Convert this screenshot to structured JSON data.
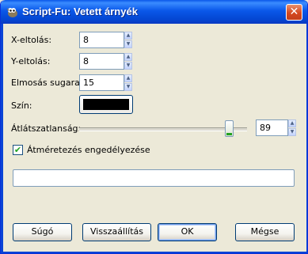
{
  "window": {
    "title": "Script-Fu: Vetett árnyék",
    "close_glyph": "✕"
  },
  "form": {
    "x_offset": {
      "label": "X-eltolás:",
      "value": "8"
    },
    "y_offset": {
      "label": "Y-eltolás:",
      "value": "8"
    },
    "blur_radius": {
      "label": "Elmosás sugara:",
      "value": "15"
    },
    "color": {
      "label": "Szín:",
      "value": "#000000"
    },
    "opacity": {
      "label": "Átlátszatlanság:",
      "value": "89",
      "fraction": 0.89
    },
    "resize_checkbox": {
      "label": "Átméretezés engedélyezése",
      "checked": true
    },
    "status_text": ""
  },
  "buttons": {
    "help": "Súgó",
    "reset": "Visszaállítás",
    "ok": "OK",
    "cancel": "Mégse"
  },
  "icons": {
    "app": "gimp-wilber-icon",
    "close": "close-icon",
    "spin_up": "arrow-up-icon",
    "spin_down": "arrow-down-icon",
    "check": "checkmark-icon"
  }
}
